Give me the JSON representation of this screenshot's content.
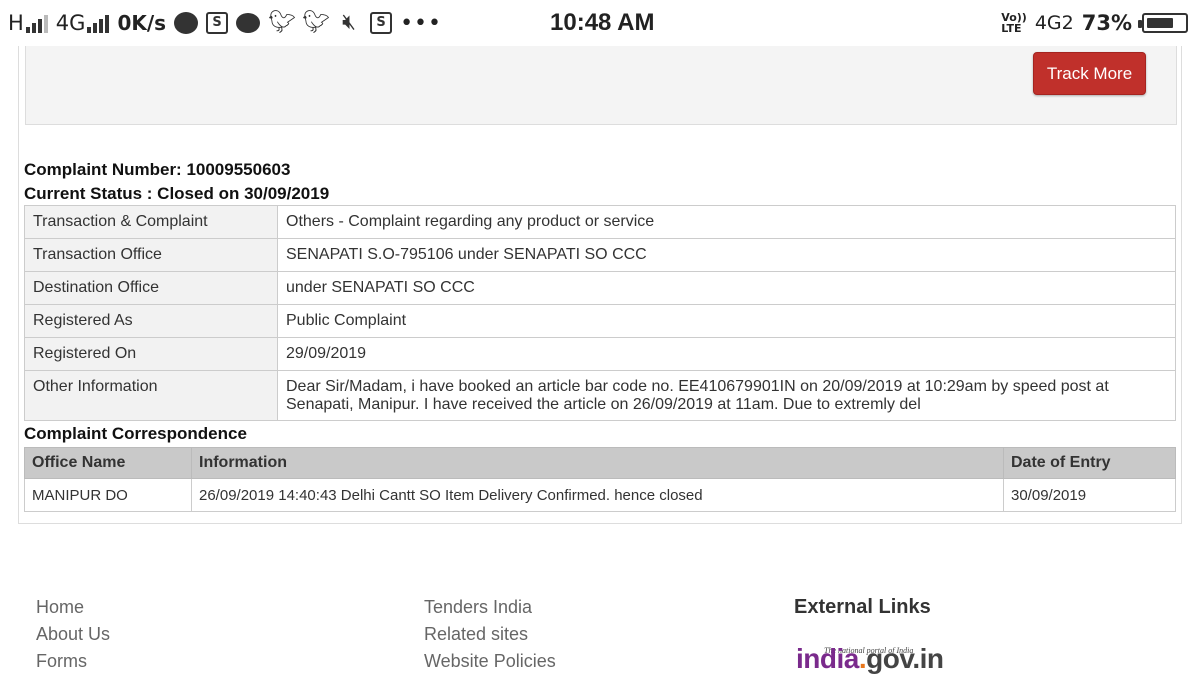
{
  "status_bar": {
    "carrier_h": "H",
    "network_type": "4G",
    "speed": "0K/s",
    "time": "10:48 AM",
    "volte_top": "Vo))",
    "volte_bottom": "LTE",
    "network_right": "4G2",
    "battery_percent": "73%",
    "battery_level": 0.73,
    "notification_icons": [
      "messenger-icon",
      "shareit-icon",
      "chat-bubble-icon",
      "twitter-icon",
      "twitter-icon",
      "mute-icon",
      "shareit-icon",
      "more-dots-icon"
    ]
  },
  "track_more_label": "Track More",
  "complaint": {
    "number_line": "Complaint Number: 10009550603",
    "status_line": "Current Status : Closed on 30/09/2019"
  },
  "details": [
    {
      "label": "Transaction & Complaint",
      "value": "Others - Complaint regarding any product or service"
    },
    {
      "label": "Transaction Office",
      "value": "SENAPATI S.O-795106 under SENAPATI SO CCC"
    },
    {
      "label": "Destination Office",
      "value": "under SENAPATI SO CCC"
    },
    {
      "label": "Registered As",
      "value": "Public Complaint"
    },
    {
      "label": "Registered On",
      "value": "29/09/2019"
    },
    {
      "label": "Other Information",
      "value": "Dear Sir/Madam, i have booked an article bar code no. EE410679901IN on 20/09/2019 at 10:29am by speed post at Senapati, Manipur. I have received the article on 26/09/2019 at 11am. Due to extremly del"
    }
  ],
  "correspondence": {
    "title": "Complaint Correspondence",
    "headers": [
      "Office Name",
      "Information",
      "Date of Entry"
    ],
    "rows": [
      [
        "MANIPUR DO",
        "26/09/2019 14:40:43 Delhi Cantt SO Item Delivery Confirmed. hence closed",
        "30/09/2019"
      ]
    ]
  },
  "footer": {
    "col1": [
      "Home",
      "About Us",
      "Forms"
    ],
    "col2": [
      "Tenders India",
      "Related sites",
      "Website Policies"
    ],
    "external_title": "External Links",
    "logo_tagline": "The national portal of India",
    "logo_india": "india",
    "logo_dot": ".",
    "logo_gov": "gov.in"
  },
  "colors": {
    "track_button": "#c0302b",
    "header_row": "#c9c9c9",
    "label_cell": "#f2f2f2",
    "logo_purple": "#7a2a8c",
    "logo_orange": "#e8761b"
  }
}
